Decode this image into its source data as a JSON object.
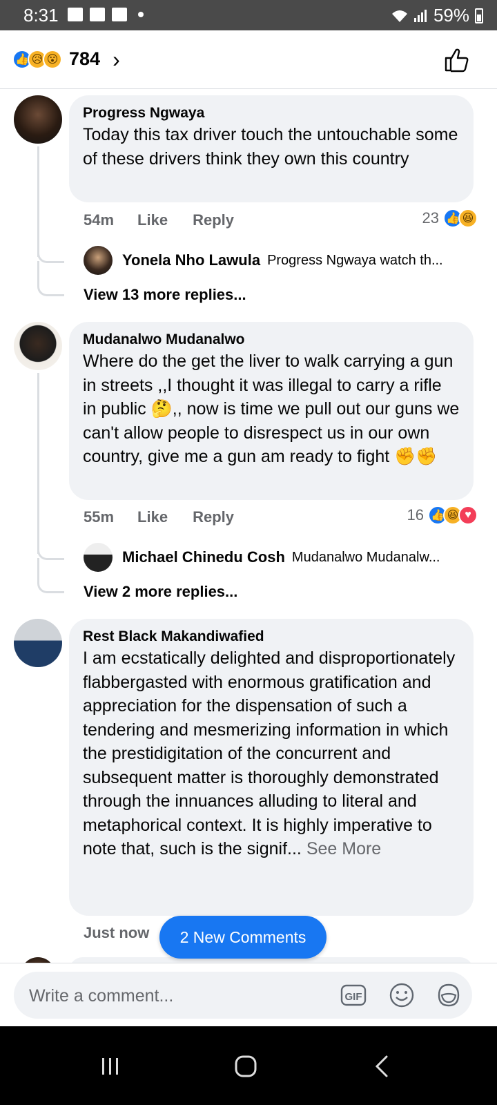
{
  "status_bar": {
    "time": "8:31",
    "battery": "59%"
  },
  "header": {
    "reaction_count": "784",
    "reaction_icons": [
      "like",
      "sad",
      "wow"
    ]
  },
  "comments": [
    {
      "author": "Progress Ngwaya",
      "text": "Today this tax driver touch the untouchable some of these drivers  think  they own this country",
      "time": "54m",
      "like_label": "Like",
      "reply_label": "Reply",
      "reaction_count": "23",
      "reactions": [
        "like",
        "haha"
      ],
      "reply_preview": {
        "author": "Yonela Nho Lawula",
        "text": "Progress Ngwaya watch th..."
      },
      "view_more": "View 13 more replies..."
    },
    {
      "author": "Mudanalwo Mudanalwo",
      "text": "Where do the get the liver  to  walk  carrying a gun in streets ,,I thought  it was illegal  to carry a rifle in public 🤔,,  now is time we pull out  our guns  we can't  allow  people  to disrespect us in our  own  country,   give me a gun am ready  to fight ✊✊",
      "time": "55m",
      "like_label": "Like",
      "reply_label": "Reply",
      "reaction_count": "16",
      "reactions": [
        "like",
        "haha",
        "love"
      ],
      "reply_preview": {
        "author": "Michael Chinedu Cosh",
        "text": "Mudanalwo Mudanalw..."
      },
      "view_more": "View 2 more replies..."
    },
    {
      "author": "Rest Black Makandiwafied",
      "text": "I am ecstatically delighted and disproportionately flabbergasted with enormous gratification and appreciation for the dispensation of such a tendering and mesmerizing information in which the prestidigitation of the concurrent and subsequent matter is thoroughly demonstrated through the innuances alluding to literal and metaphorical context. It is highly imperative to note that, such is the signif...",
      "see_more": "See More",
      "time": "Just now"
    }
  ],
  "new_comments_label": "2 New Comments",
  "composer": {
    "placeholder": "Write a comment...",
    "gif_label": "GIF"
  },
  "colors": {
    "accent": "#1877f2",
    "bubble": "#f0f2f5",
    "muted": "#65676b"
  }
}
